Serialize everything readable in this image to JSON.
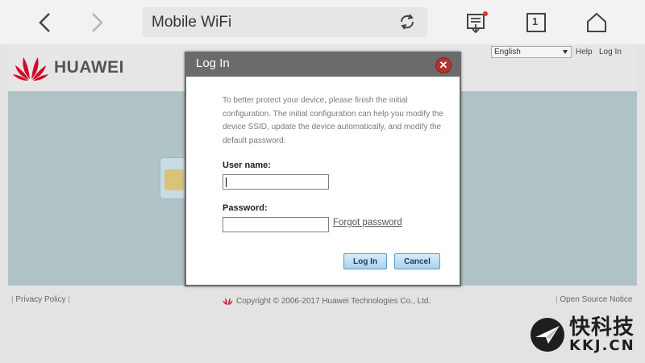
{
  "browser": {
    "title": "Mobile WiFi",
    "tab_count": "1"
  },
  "header": {
    "logo_text": "HUAWEI",
    "language": "English",
    "help_label": "Help",
    "login_label": "Log In"
  },
  "footer": {
    "privacy_label": "Privacy Policy",
    "copyright": "Copyright © 2006-2017 Huawei Technologies Co., Ltd.",
    "open_source_label": "Open Source Notice"
  },
  "dialog": {
    "title": "Log In",
    "intro": "To better protect your device, please finish the initial configuration. The initial configuration can help you modify the device SSID, update the device automatically, and modify the default password.",
    "username_label": "User name:",
    "username_value": "",
    "password_label": "Password:",
    "password_value": "",
    "forgot_label": "Forgot password",
    "login_button": "Log In",
    "cancel_button": "Cancel"
  },
  "watermark": {
    "cn": "快科技",
    "en": "KKJ.CN"
  },
  "colors": {
    "dialog_title_bg": "#6b6b6b",
    "close_button": "#b3332f",
    "main_area": "#afc2c6",
    "huawei_red": "#cf0a2c",
    "notification_dot": "#e5332a"
  }
}
